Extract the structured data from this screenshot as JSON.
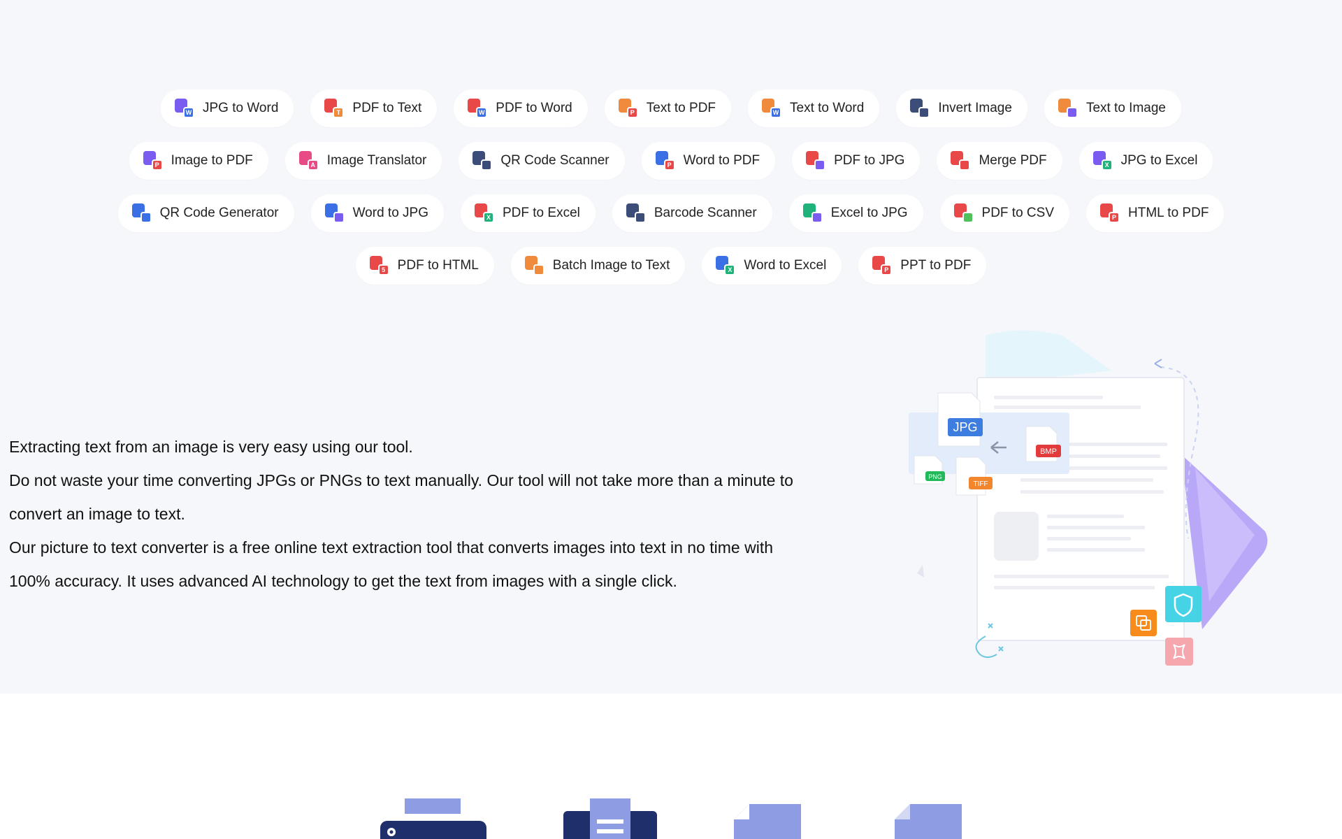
{
  "tools": [
    [
      {
        "label": "JPG to Word",
        "icon": "jpg-to-word-icon",
        "a": "c-purple",
        "b": "c-blue",
        "glyph": "W"
      },
      {
        "label": "PDF to Text",
        "icon": "pdf-to-text-icon",
        "a": "c-red",
        "b": "c-orange",
        "glyph": "T"
      },
      {
        "label": "PDF to Word",
        "icon": "pdf-to-word-icon",
        "a": "c-red",
        "b": "c-blue",
        "glyph": "W"
      },
      {
        "label": "Text to PDF",
        "icon": "text-to-pdf-icon",
        "a": "c-orange",
        "b": "c-red",
        "glyph": "P"
      },
      {
        "label": "Text to Word",
        "icon": "text-to-word-icon",
        "a": "c-orange",
        "b": "c-blue",
        "glyph": "W"
      },
      {
        "label": "Invert Image",
        "icon": "invert-image-icon",
        "a": "c-navy",
        "b": "c-navy",
        "glyph": ""
      },
      {
        "label": "Text to Image",
        "icon": "text-to-image-icon",
        "a": "c-orange",
        "b": "c-purple",
        "glyph": ""
      }
    ],
    [
      {
        "label": "Image to PDF",
        "icon": "image-to-pdf-icon",
        "a": "c-purple",
        "b": "c-red",
        "glyph": "P"
      },
      {
        "label": "Image Translator",
        "icon": "image-translator-icon",
        "a": "c-pink",
        "b": "c-pink",
        "glyph": "A"
      },
      {
        "label": "QR Code Scanner",
        "icon": "qr-code-scanner-icon",
        "a": "c-navy",
        "b": "c-navy",
        "glyph": ""
      },
      {
        "label": "Word to PDF",
        "icon": "word-to-pdf-icon",
        "a": "c-blue",
        "b": "c-red",
        "glyph": "P"
      },
      {
        "label": "PDF to JPG",
        "icon": "pdf-to-jpg-icon",
        "a": "c-red",
        "b": "c-purple",
        "glyph": ""
      },
      {
        "label": "Merge PDF",
        "icon": "merge-pdf-icon",
        "a": "c-red",
        "b": "c-red",
        "glyph": ""
      },
      {
        "label": "JPG to Excel",
        "icon": "jpg-to-excel-icon",
        "a": "c-purple",
        "b": "c-green",
        "glyph": "X"
      }
    ],
    [
      {
        "label": "QR Code Generator",
        "icon": "qr-code-generator-icon",
        "a": "c-blue",
        "b": "c-blue",
        "glyph": ""
      },
      {
        "label": "Word to JPG",
        "icon": "word-to-jpg-icon",
        "a": "c-blue",
        "b": "c-purple",
        "glyph": ""
      },
      {
        "label": "PDF to Excel",
        "icon": "pdf-to-excel-icon",
        "a": "c-red",
        "b": "c-green",
        "glyph": "X"
      },
      {
        "label": "Barcode Scanner",
        "icon": "barcode-scanner-icon",
        "a": "c-navy",
        "b": "c-navy",
        "glyph": ""
      },
      {
        "label": "Excel to JPG",
        "icon": "excel-to-jpg-icon",
        "a": "c-green",
        "b": "c-purple",
        "glyph": ""
      },
      {
        "label": "PDF to CSV",
        "icon": "pdf-to-csv-icon",
        "a": "c-red",
        "b": "c-lime",
        "glyph": ""
      },
      {
        "label": "HTML to PDF",
        "icon": "html-to-pdf-icon",
        "a": "c-red",
        "b": "c-red",
        "glyph": "P"
      }
    ],
    [
      {
        "label": "PDF to HTML",
        "icon": "pdf-to-html-icon",
        "a": "c-red",
        "b": "c-red",
        "glyph": "5"
      },
      {
        "label": "Batch Image to Text",
        "icon": "batch-image-to-text-icon",
        "a": "c-orange",
        "b": "c-orange",
        "glyph": ""
      },
      {
        "label": "Word to Excel",
        "icon": "word-to-excel-icon",
        "a": "c-blue",
        "b": "c-green",
        "glyph": "X"
      },
      {
        "label": "PPT to PDF",
        "icon": "ppt-to-pdf-icon",
        "a": "c-red",
        "b": "c-red",
        "glyph": "P"
      }
    ]
  ],
  "description": [
    "Extracting text from an image is very easy using our tool.",
    "Do not waste your time converting JPGs or PNGs to text manually. Our tool will not take more than a minute to",
    "convert an image to text.",
    "Our picture to text converter is a free online text extraction tool that converts images into text in no time with",
    "100% accuracy. It uses advanced AI technology to get the text from images with a single click."
  ],
  "illustration": {
    "jpg_label": "JPG",
    "bmp_label": "BMP",
    "png_label": "PNG",
    "tiff_label": "TIFF"
  },
  "colors": {
    "page_bg": "#f6f7fb",
    "chip_bg": "#ffffff",
    "accent_purple": "#7b5cf0",
    "accent_blue": "#3b6fe6",
    "accent_red": "#e84848",
    "accent_orange": "#f08a3c",
    "accent_green": "#1fb37a",
    "navy": "#2b3a6b"
  }
}
